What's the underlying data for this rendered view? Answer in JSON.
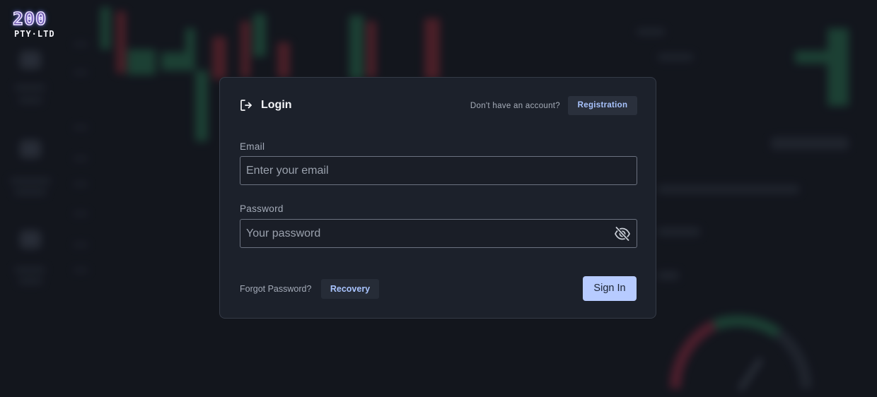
{
  "logo": {
    "number": "200",
    "subtitle": "PTY·LTD"
  },
  "login": {
    "title": "Login",
    "icon": "login-arrow-icon",
    "no_account_text": "Don't have an account?",
    "registration_label": "Registration"
  },
  "form": {
    "email_label": "Email",
    "email_value": "",
    "email_placeholder": "Enter your email",
    "password_label": "Password",
    "password_value": "",
    "password_placeholder": "Your password",
    "password_toggle_icon": "eye-slash-icon"
  },
  "footer": {
    "forgot_text": "Forgot Password?",
    "recovery_label": "Recovery",
    "signin_label": "Sign In"
  },
  "colors": {
    "accent": "#b7cbff",
    "link": "#a9c4ff",
    "modal_bg": "#1c212b",
    "page_bg": "#14171e"
  }
}
